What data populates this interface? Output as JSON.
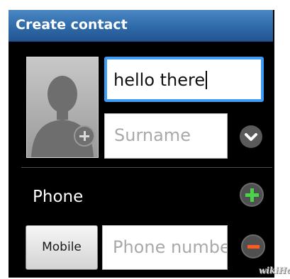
{
  "header": {
    "title": "Create contact"
  },
  "photo": {
    "icon": "person-silhouette-icon",
    "add_icon": "plus-circle-icon"
  },
  "name_field": {
    "value": "hello there"
  },
  "surname_field": {
    "placeholder": "Surname",
    "expand_icon": "chevron-down-icon"
  },
  "phone_section": {
    "label": "Phone",
    "add_icon": "plus-icon",
    "type_button": "Mobile",
    "number_placeholder": "Phone number",
    "remove_icon": "minus-icon"
  },
  "colors": {
    "title_bar": "#2f6aa9",
    "focus_border": "#3f9cf5",
    "add_green": "#4ad24a",
    "remove_orange": "#ff5a1f"
  },
  "watermark": "wikiHow"
}
